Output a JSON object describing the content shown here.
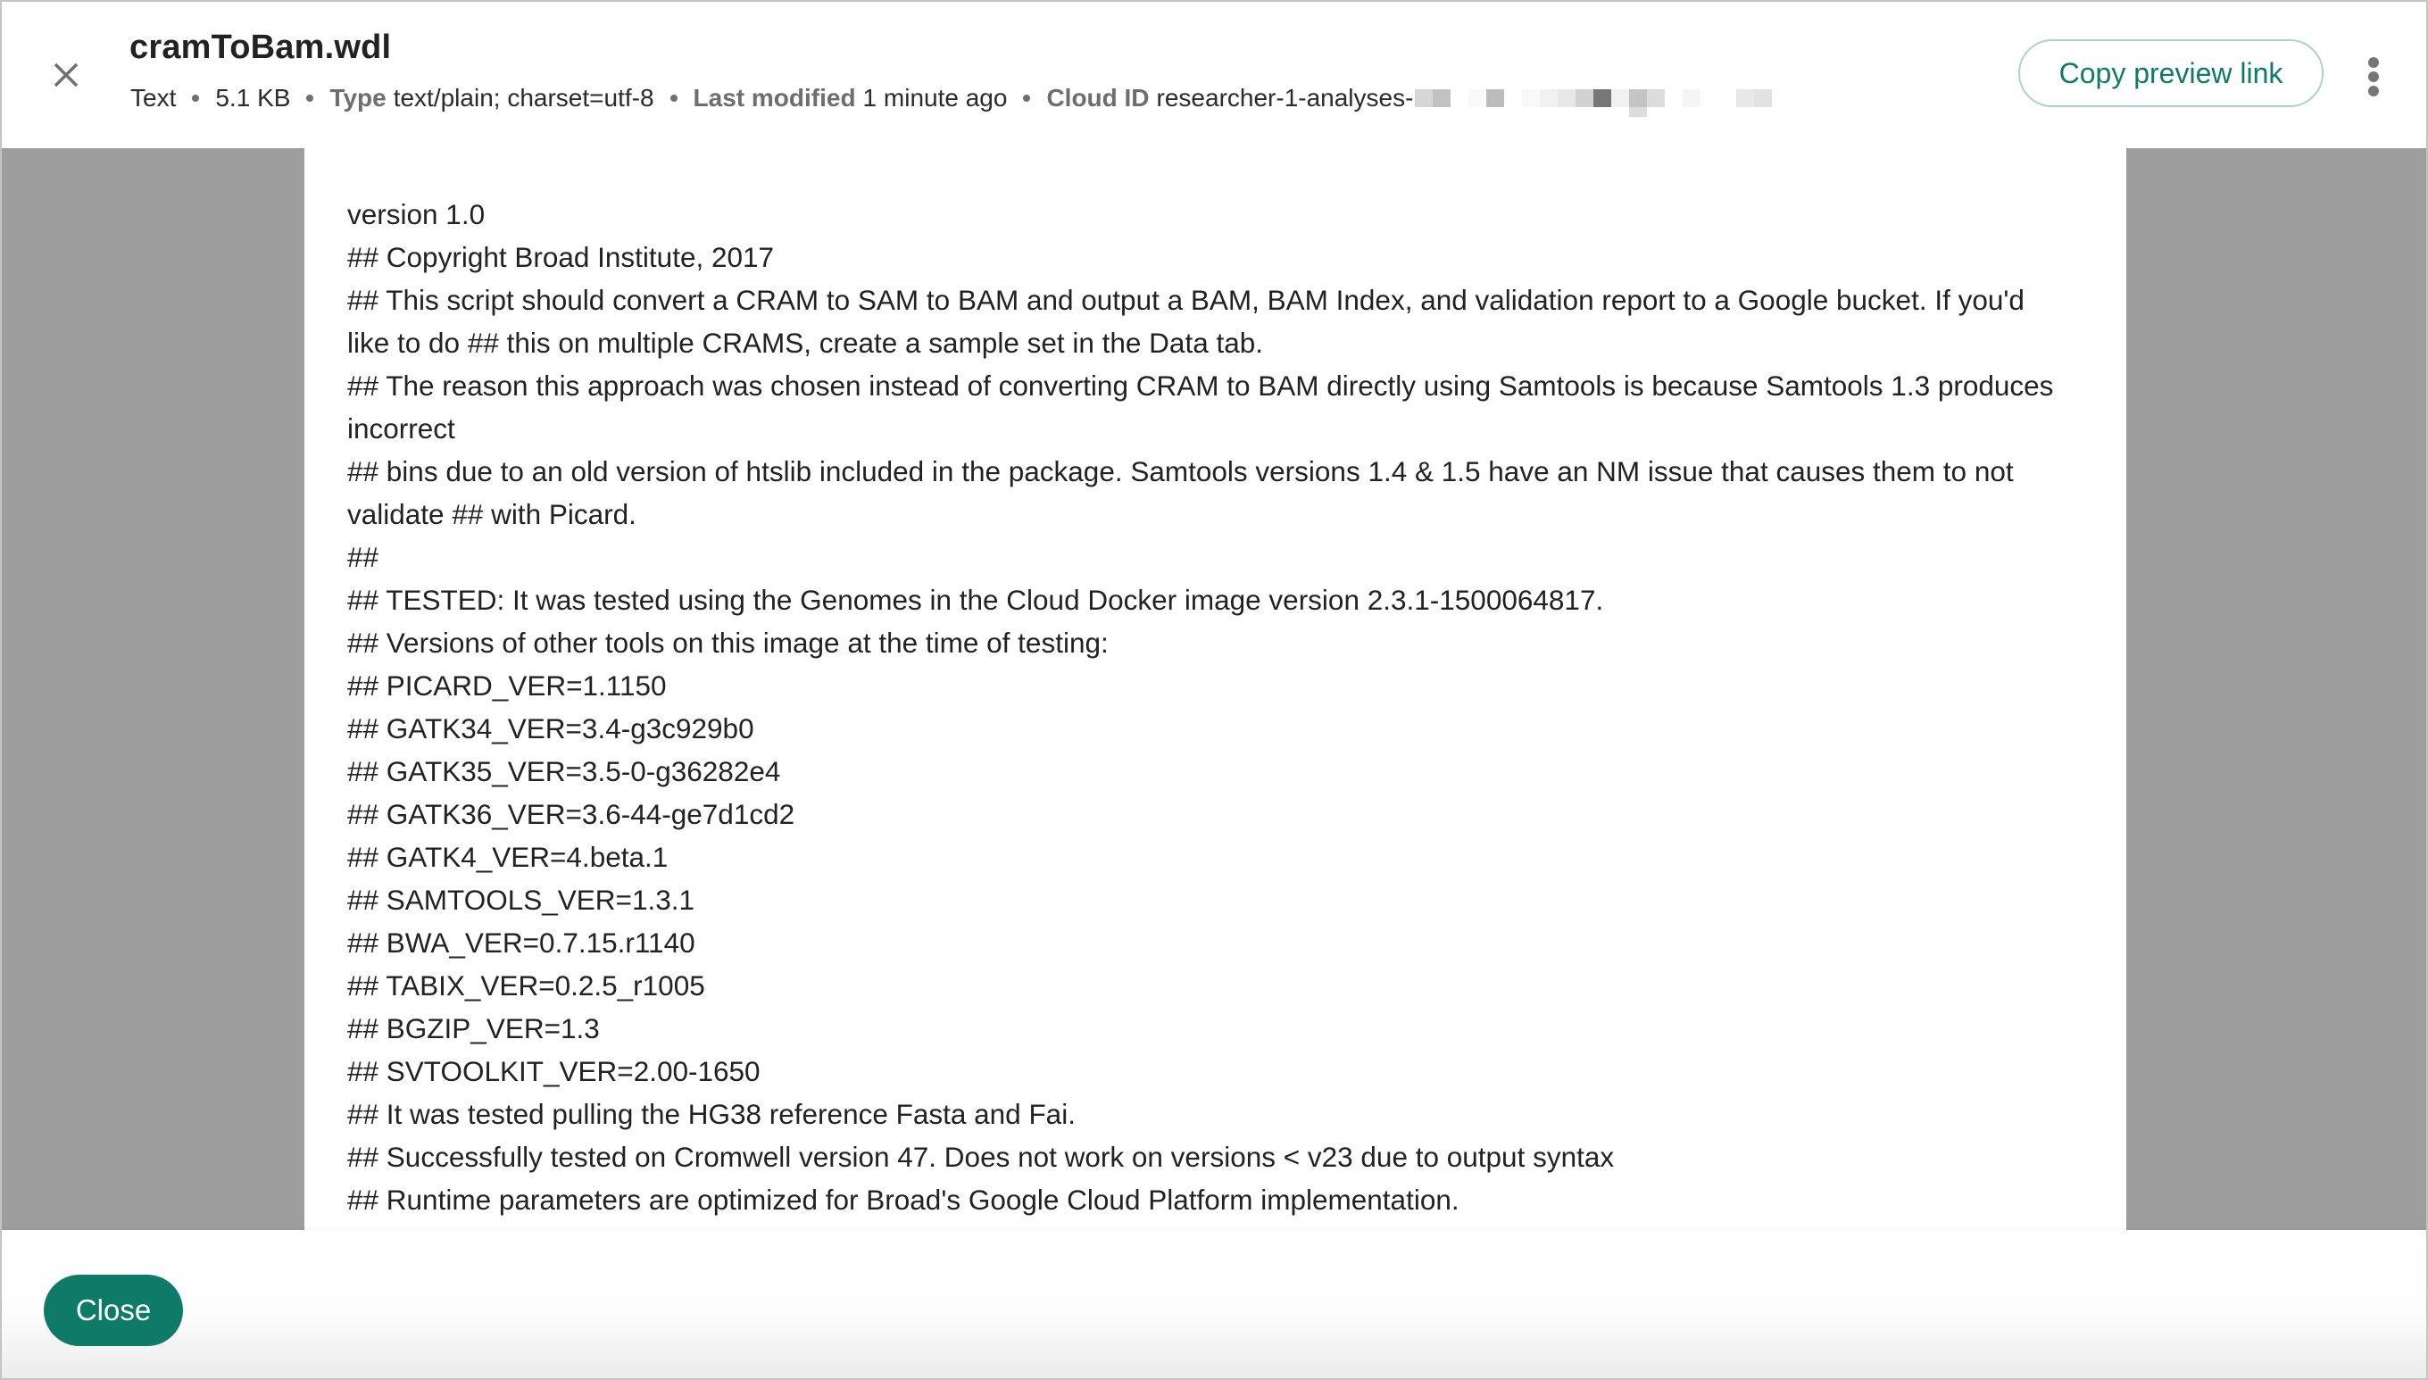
{
  "header": {
    "title": "cramToBam.wdl",
    "meta": {
      "kind": "Text",
      "size": "5.1 KB",
      "type_label": "Type",
      "type_value": "text/plain; charset=utf-8",
      "modified_label": "Last modified",
      "modified_value": "1 minute ago",
      "cloud_label": "Cloud ID",
      "cloud_value": "researcher-1-analyses-",
      "cloud_value_redacted": true
    },
    "copy_link_label": "Copy preview link",
    "close_icon": "close-icon",
    "more_icon": "more-vert-icon"
  },
  "document": {
    "lines": [
      "version 1.0",
      "## Copyright Broad Institute, 2017",
      "## This script should convert a CRAM to SAM to BAM and output a BAM, BAM Index, and validation report to a Google bucket. If you'd like to do ## this on multiple CRAMS, create a sample set in the Data tab.",
      "## The reason this approach was chosen instead of converting CRAM to BAM directly using Samtools is because Samtools 1.3 produces incorrect",
      "## bins due to an old version of htslib included in the package. Samtools versions 1.4 & 1.5 have an NM issue that causes them to not validate ## with Picard.",
      "##",
      "## TESTED: It was tested using the Genomes in the Cloud Docker image version 2.3.1-1500064817.",
      "## Versions of other tools on this image at the time of testing:",
      "## PICARD_VER=1.1150",
      "## GATK34_VER=3.4-g3c929b0",
      "## GATK35_VER=3.5-0-g36282e4",
      "## GATK36_VER=3.6-44-ge7d1cd2",
      "## GATK4_VER=4.beta.1",
      "## SAMTOOLS_VER=1.3.1",
      "## BWA_VER=0.7.15.r1140",
      "## TABIX_VER=0.2.5_r1005",
      "## BGZIP_VER=1.3",
      "## SVTOOLKIT_VER=2.00-1650",
      "## It was tested pulling the HG38 reference Fasta and Fai.",
      "## Successfully tested on Cromwell version 47. Does not work on versions < v23 due to output syntax",
      "## Runtime parameters are optimized for Broad's Google Cloud Platform implementation.",
      "##"
    ]
  },
  "footer": {
    "close_label": "Close"
  },
  "colors": {
    "accent": "#0e7a68",
    "accent_text": "#0f7a66",
    "outline": "#a9d3cc",
    "viewer_bg": "#9e9e9e"
  }
}
